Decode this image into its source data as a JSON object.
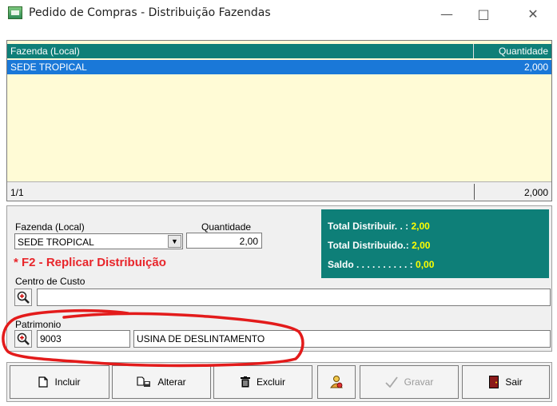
{
  "window": {
    "title": "Pedido de Compras - Distribuição Fazendas",
    "minimize_glyph": "—",
    "maximize_glyph": "□",
    "close_glyph": "✕"
  },
  "grid": {
    "columns": [
      "Fazenda (Local)",
      "Quantidade"
    ],
    "rows": [
      {
        "fazenda": "SEDE TROPICAL",
        "quantidade": "2,000"
      }
    ],
    "footer": {
      "position": "1/1",
      "total": "2,000"
    }
  },
  "form": {
    "fazenda_label": "Fazenda (Local)",
    "fazenda_value": "SEDE TROPICAL",
    "quantidade_label": "Quantidade",
    "quantidade_value": "2,00",
    "replicar_text": "* F2 - Replicar Distribuição",
    "centro_custo_label": "Centro de Custo",
    "centro_custo_value": "",
    "patrimonio_label": "Patrimonio",
    "patrimonio_code": "9003",
    "patrimonio_desc": "USINA DE DESLINTAMENTO"
  },
  "totals": {
    "distribuir_label": "Total Distribuir. . :",
    "distribuir_value": "2,00",
    "distribuido_label": "Total Distribuido.:",
    "distribuido_value": "2,00",
    "saldo_label": "Saldo . . . . . . . . . . :",
    "saldo_value": "0,00"
  },
  "buttons": {
    "incluir": "Incluir",
    "alterar": "Alterar",
    "excluir": "Excluir",
    "gravar": "Gravar",
    "sair": "Sair"
  },
  "colors": {
    "teal": "#0e7f78",
    "selection": "#1a78d8",
    "grid_bg": "#fffbd6",
    "alert_red": "#e8262b",
    "highlight_yellow": "#ffff00"
  }
}
